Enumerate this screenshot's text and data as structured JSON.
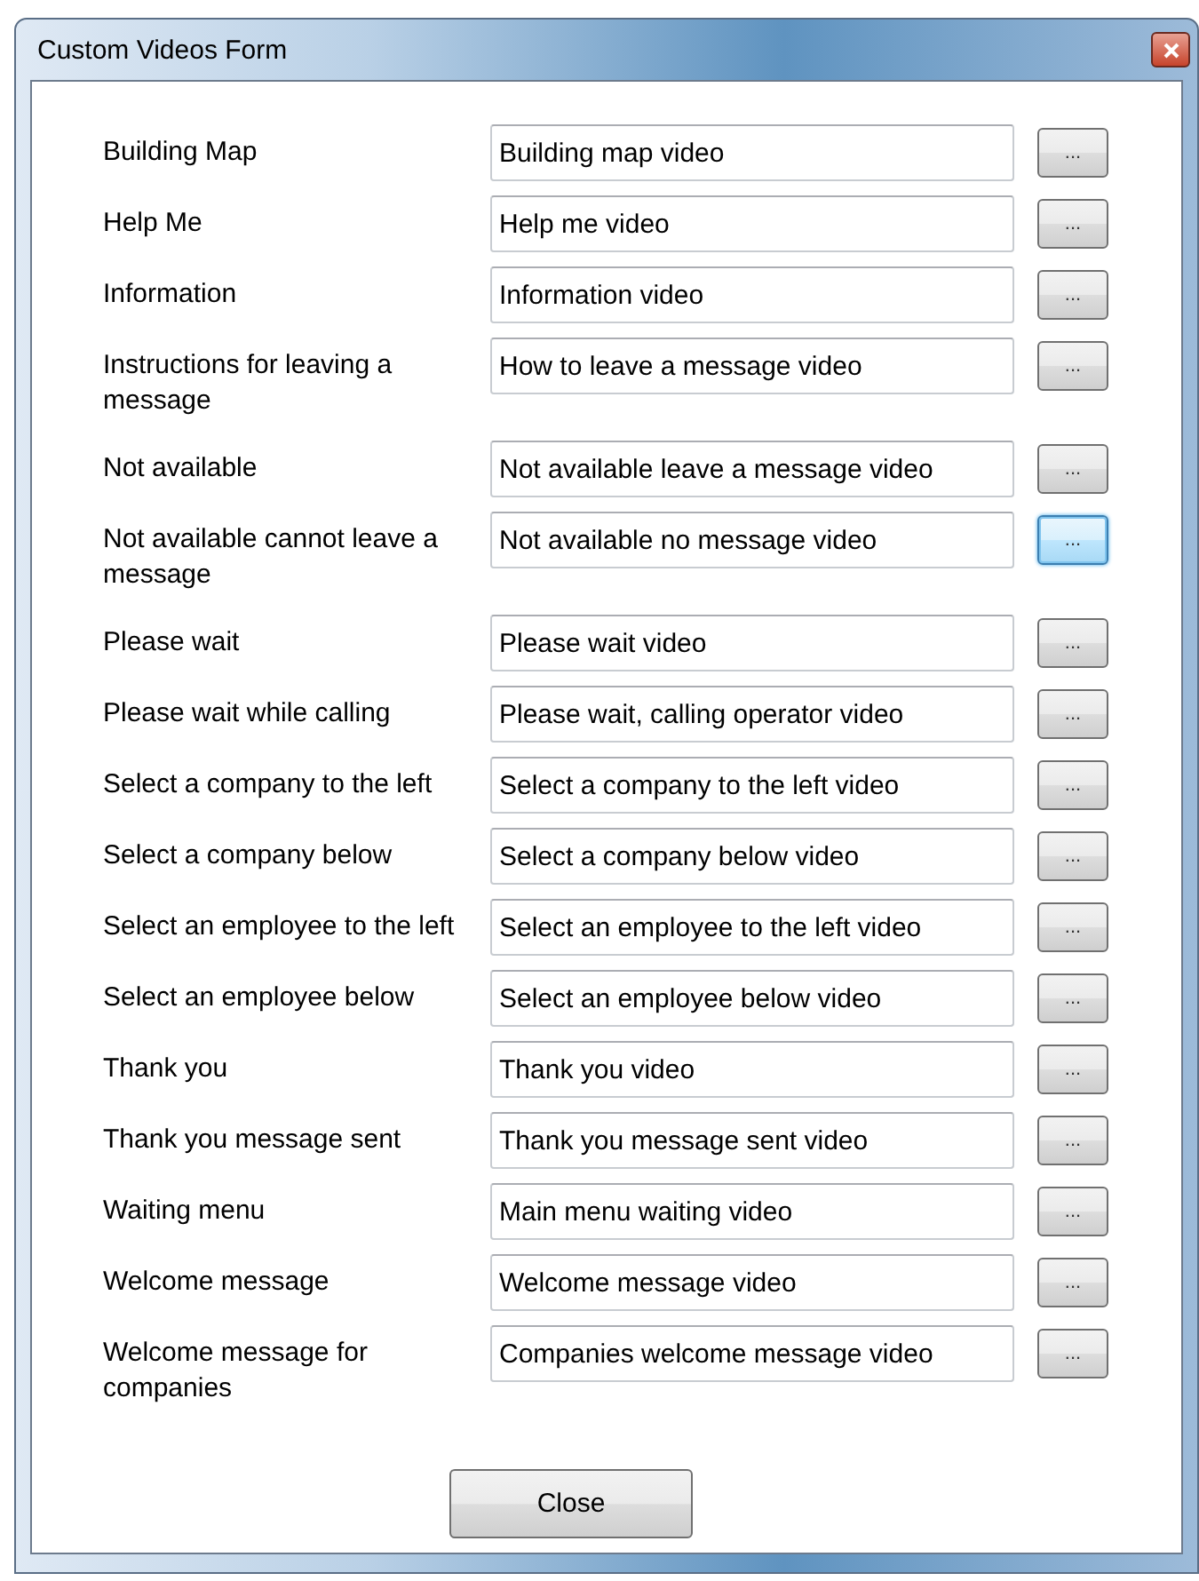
{
  "window": {
    "title": "Custom Videos Form"
  },
  "rows": [
    {
      "label": "Building Map",
      "value": "Building map video",
      "button": "...",
      "focused": false
    },
    {
      "label": "Help Me",
      "value": "Help me video",
      "button": "...",
      "focused": false
    },
    {
      "label": "Information",
      "value": "Information video",
      "button": "...",
      "focused": false
    },
    {
      "label": "Instructions for leaving a message",
      "value": "How to leave a message video",
      "button": "...",
      "focused": false
    },
    {
      "label": "Not available",
      "value": "Not available leave a message video",
      "button": "...",
      "focused": false
    },
    {
      "label": "Not available cannot leave a message",
      "value": "Not available no message video",
      "button": "...",
      "focused": true
    },
    {
      "label": "Please wait",
      "value": "Please wait video",
      "button": "...",
      "focused": false
    },
    {
      "label": "Please wait while calling",
      "value": "Please wait, calling operator video",
      "button": "...",
      "focused": false
    },
    {
      "label": "Select a company to the left",
      "value": "Select a company to the left video",
      "button": "...",
      "focused": false
    },
    {
      "label": "Select a company below",
      "value": "Select a company below video",
      "button": "...",
      "focused": false
    },
    {
      "label": "Select an employee to the left",
      "value": "Select an employee to the left video",
      "button": "...",
      "focused": false
    },
    {
      "label": "Select an employee below",
      "value": "Select an employee below video",
      "button": "...",
      "focused": false
    },
    {
      "label": "Thank you",
      "value": "Thank you video",
      "button": "...",
      "focused": false
    },
    {
      "label": "Thank you message sent",
      "value": "Thank you message sent video",
      "button": "...",
      "focused": false
    },
    {
      "label": "Waiting menu",
      "value": "Main menu waiting video",
      "button": "...",
      "focused": false
    },
    {
      "label": "Welcome message",
      "value": "Welcome message video",
      "button": "...",
      "focused": false
    },
    {
      "label": "Welcome message for companies",
      "value": "Companies welcome message video",
      "button": "...",
      "focused": false
    }
  ],
  "close_button": "Close"
}
